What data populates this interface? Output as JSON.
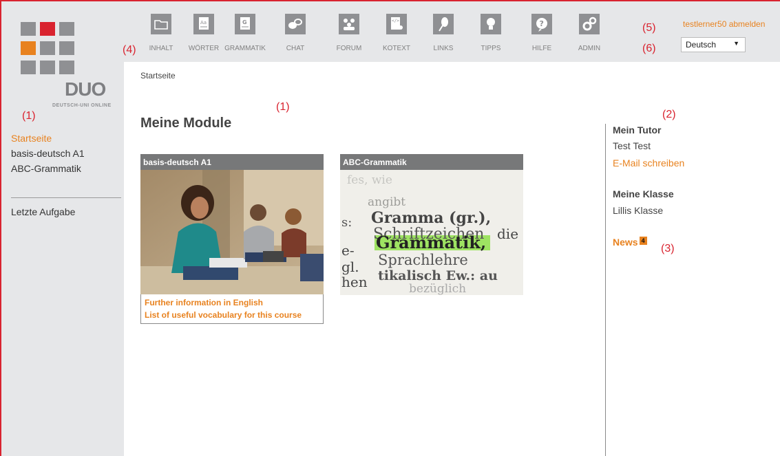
{
  "annotations": {
    "nav_marker": "(4)",
    "sidebar_marker": "(1)",
    "modules_marker": "(1)",
    "tutor_marker": "(2)",
    "news_marker": "(3)",
    "logout_marker": "(5)",
    "lang_marker": "(6)"
  },
  "logo": {
    "text": "DUO",
    "subtitle": "DEUTSCH-UNI ONLINE"
  },
  "sidebar": {
    "items": [
      {
        "label": "Startseite",
        "active": true
      },
      {
        "label": "basis-deutsch A1",
        "active": false
      },
      {
        "label": "ABC-Grammatik",
        "active": false
      }
    ],
    "last_task": "Letzte Aufgabe"
  },
  "topnav": {
    "items": [
      {
        "label": "INHALT",
        "icon": "folder-icon"
      },
      {
        "label": "WÖRTER",
        "icon": "dictionary-icon"
      },
      {
        "label": "GRAMMATIK",
        "icon": "grammar-icon"
      },
      {
        "label": "CHAT",
        "icon": "chat-icon"
      },
      {
        "label": "FORUM",
        "icon": "forum-icon"
      },
      {
        "label": "KOTEXT",
        "icon": "code-document-icon"
      },
      {
        "label": "LINKS",
        "icon": "links-icon"
      },
      {
        "label": "TIPPS",
        "icon": "lightbulb-icon"
      },
      {
        "label": "HILFE",
        "icon": "help-icon"
      },
      {
        "label": "ADMIN",
        "icon": "gears-icon"
      }
    ],
    "logout": "testlerner50 abmelden",
    "language": "Deutsch"
  },
  "breadcrumb": "Startseite",
  "main": {
    "title": "Meine Module",
    "modules": [
      {
        "title": "basis-deutsch A1",
        "links": [
          "Further information in English",
          "List of useful vocabulary for this course"
        ]
      },
      {
        "title": "ABC-Grammatik",
        "image_words": [
          "fes, wie",
          "angibt",
          "Gramma (gr.),",
          "Schriftzeichen",
          "Grammatik,",
          "Sprachlehre",
          "tikalisch Ew.: au",
          "bezüglich",
          "die",
          "gl.",
          "hen",
          "e-",
          "s:"
        ]
      }
    ]
  },
  "right": {
    "tutor_heading": "Mein Tutor",
    "tutor_name": "Test Test",
    "tutor_email": "E-Mail schreiben",
    "class_heading": "Meine Klasse",
    "class_name": "Lillis Klasse",
    "news_label": "News",
    "news_count": "4"
  },
  "colors": {
    "accent": "#e8821f",
    "annotation": "#d9232f",
    "logo_red": "#d9232f",
    "logo_orange": "#e8821f"
  }
}
